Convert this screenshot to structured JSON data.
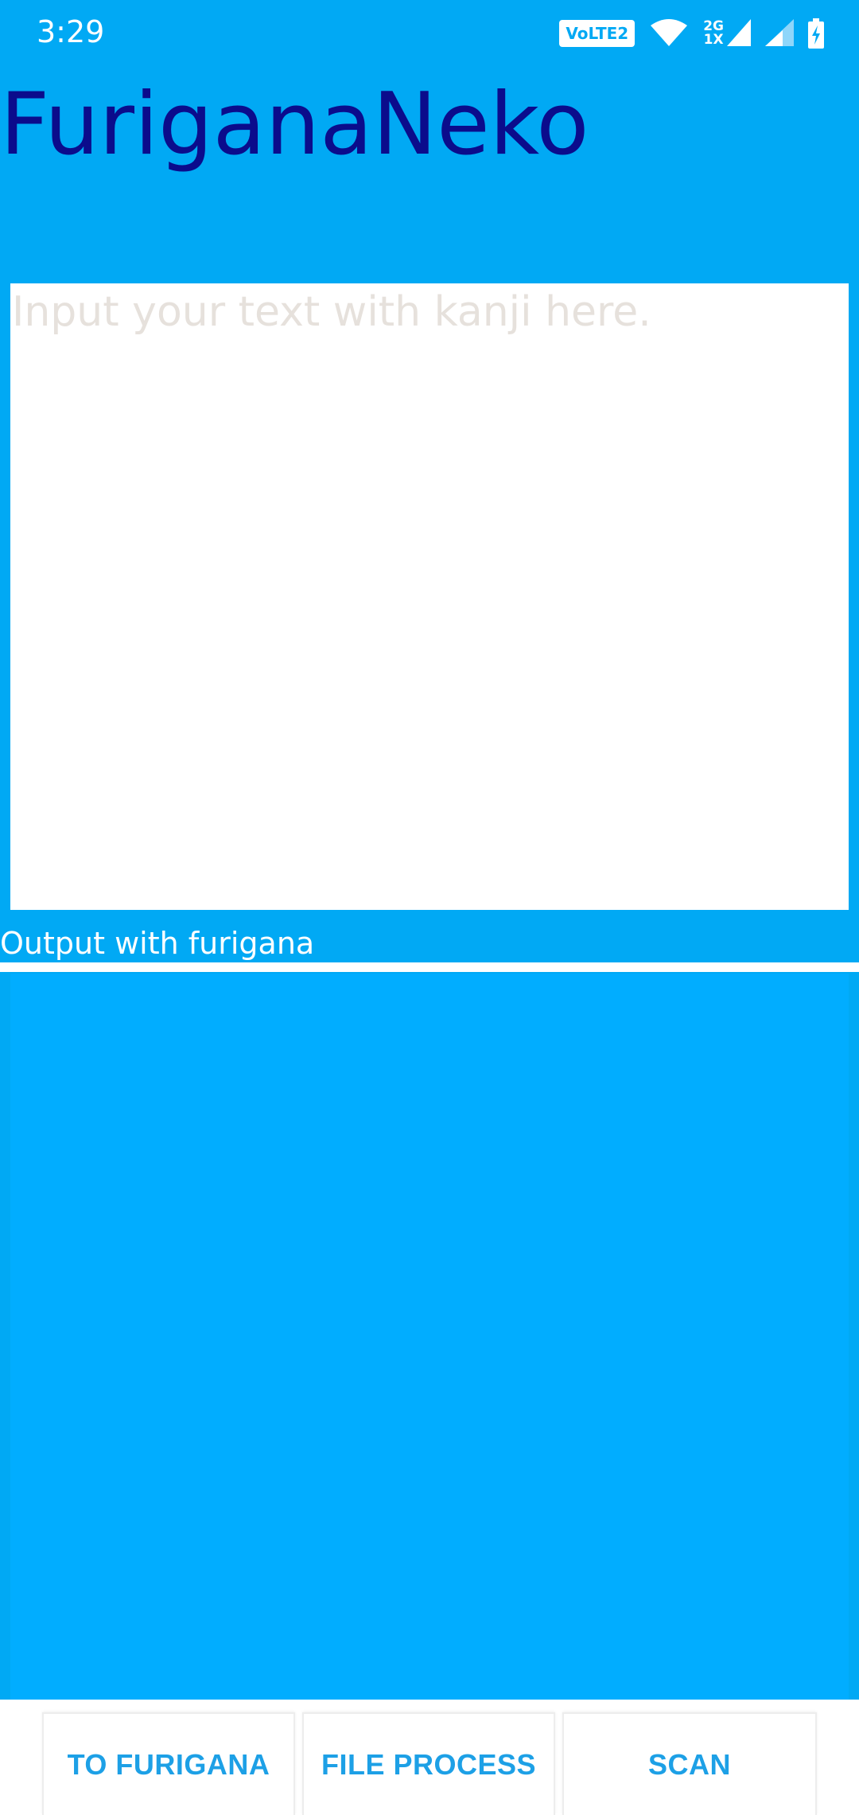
{
  "status_bar": {
    "time": "3:29",
    "volte_label": "VoLTE2",
    "network_top": "2G",
    "network_bottom": "1X",
    "icons": [
      "volte-icon",
      "wifi-icon",
      "signal-1-icon",
      "signal-2-icon",
      "battery-charging-icon"
    ]
  },
  "app": {
    "title": "FuriganaNeko",
    "title_color": "#0B0C8C",
    "background_color": "#01A9F4"
  },
  "input": {
    "placeholder": "Input your text with kanji here.",
    "value": ""
  },
  "output": {
    "label": "Output with furigana",
    "text": ""
  },
  "buttons": {
    "to_furigana": "TO FURIGANA",
    "file_process": "FILE PROCESS",
    "scan": "SCAN",
    "text_color": "#1DA0E6"
  }
}
